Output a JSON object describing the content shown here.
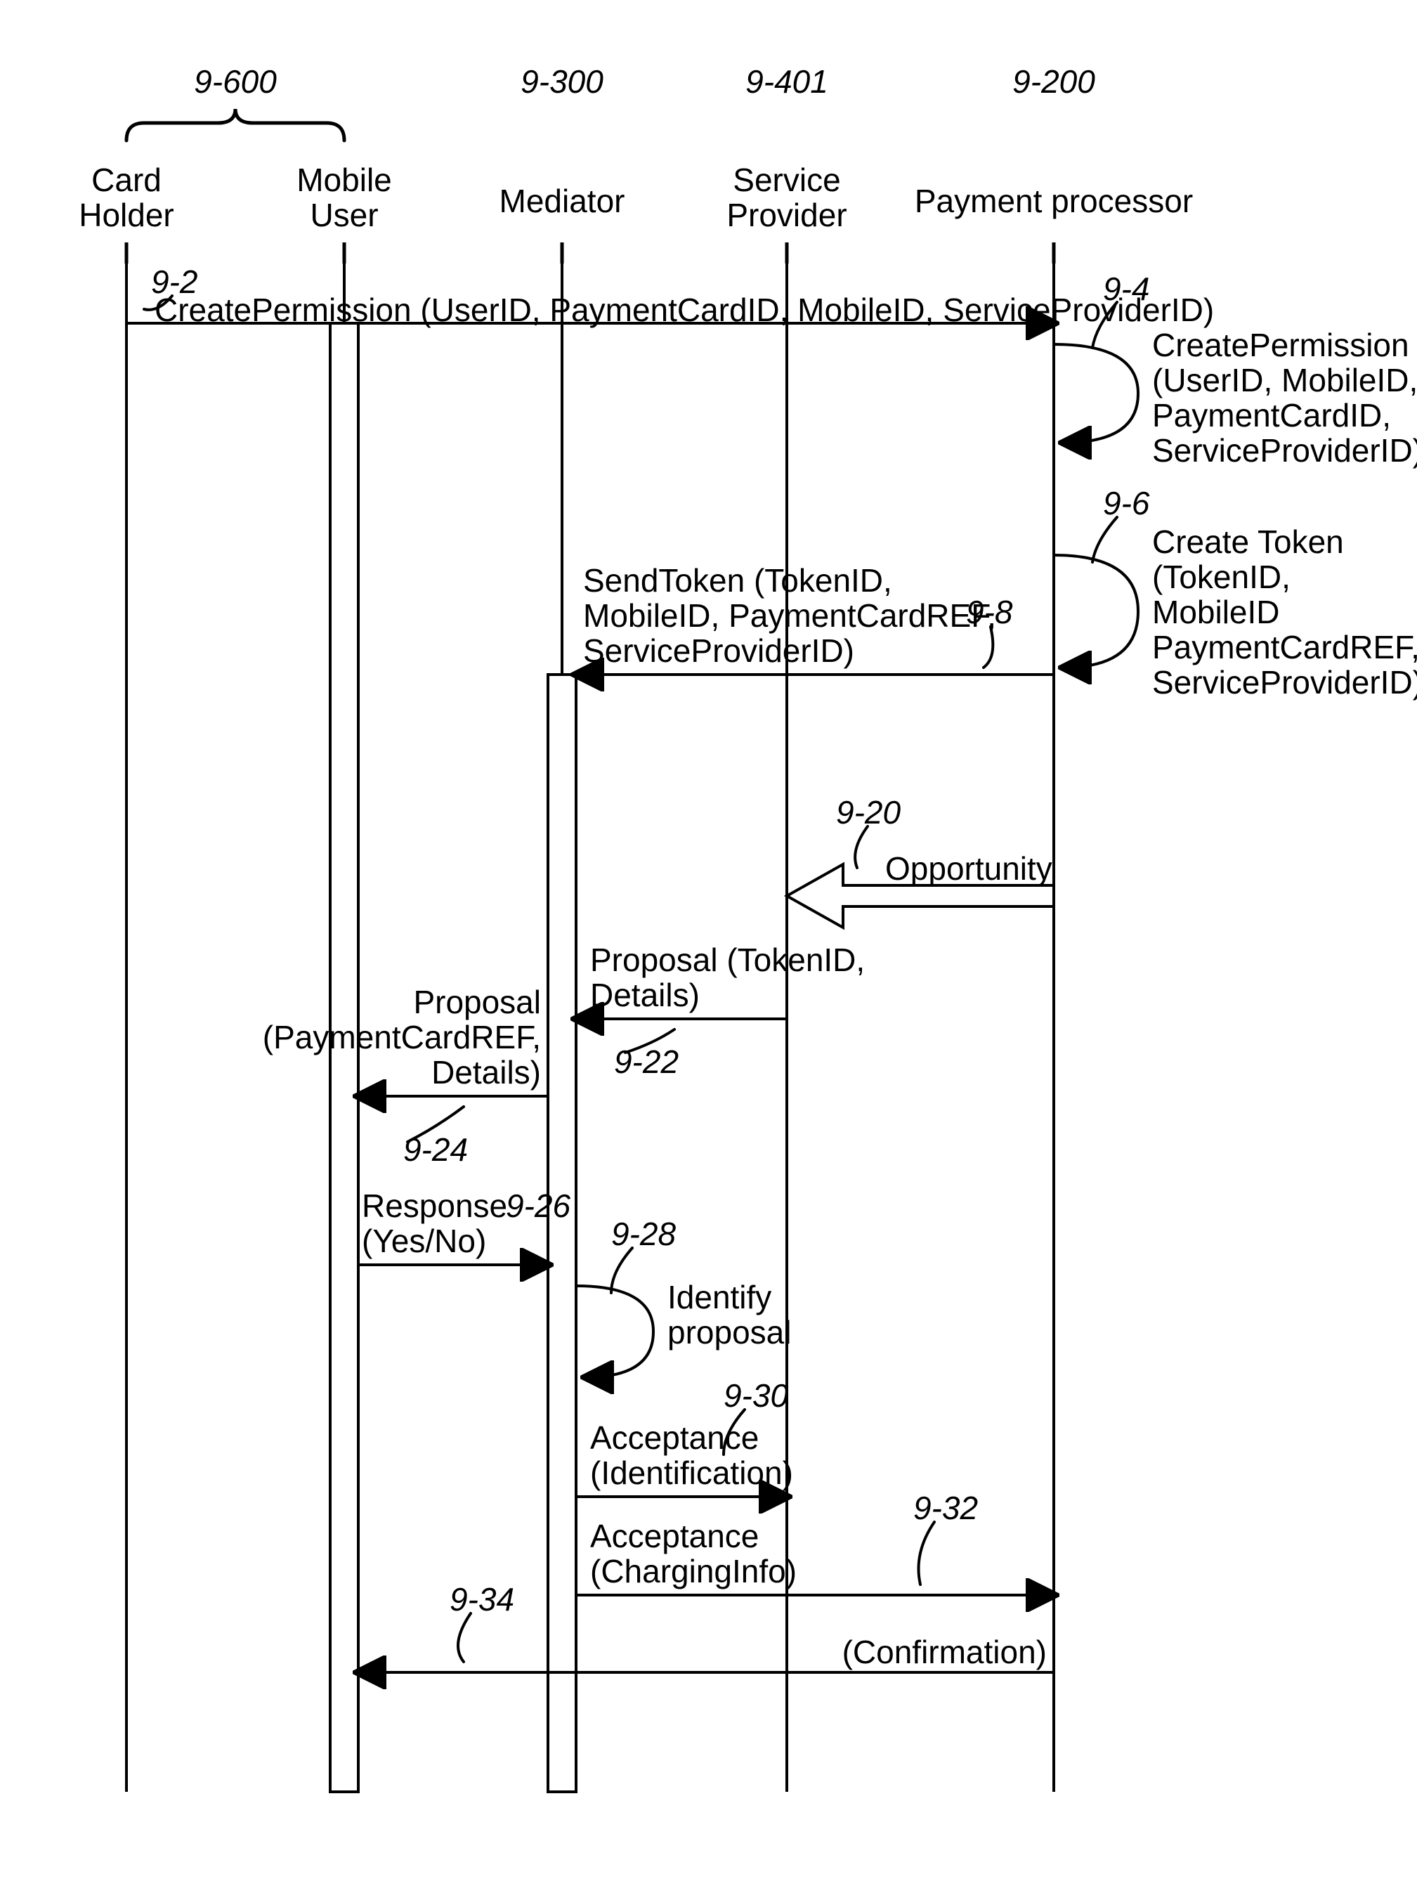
{
  "actors": {
    "cardholder": {
      "ref": "9-600",
      "label1": "Card",
      "label2": "Holder"
    },
    "mobileuser": {
      "label1": "Mobile",
      "label2": "User"
    },
    "mediator": {
      "ref": "9-300",
      "label1": "Mediator"
    },
    "provider": {
      "ref": "9-401",
      "label1": "Service",
      "label2": "Provider"
    },
    "processor": {
      "ref": "9-200",
      "label1": "Payment processor"
    }
  },
  "msgs": {
    "m2": {
      "ref": "9-2",
      "text": "CreatePermission (UserID, PaymentCardID, MobileID, ServiceProviderID)"
    },
    "m4": {
      "ref": "9-4",
      "text": [
        "CreatePermission",
        "(UserID, MobileID,",
        "PaymentCardID,",
        "ServiceProviderID)"
      ]
    },
    "m6": {
      "ref": "9-6",
      "text": [
        "Create Token",
        "(TokenID,",
        "MobileID",
        "PaymentCardREF,",
        "ServiceProviderID)"
      ]
    },
    "m8": {
      "ref": "9-8",
      "text": [
        "SendToken (TokenID,",
        "MobileID, PaymentCardREF,",
        "ServiceProviderID)"
      ]
    },
    "m20": {
      "ref": "9-20",
      "text": "Opportunity"
    },
    "m22": {
      "ref": "9-22",
      "text": [
        "Proposal (TokenID,",
        "Details)"
      ]
    },
    "m24": {
      "ref": "9-24",
      "text": [
        "Proposal",
        "(PaymentCardREF,",
        "Details)"
      ]
    },
    "m26": {
      "ref": "9-26",
      "text": [
        "Response",
        "(Yes/No)"
      ]
    },
    "m28": {
      "ref": "9-28",
      "text": [
        "Identify",
        "proposal"
      ]
    },
    "m30": {
      "ref": "9-30",
      "text": [
        "Acceptance",
        "(Identification)"
      ]
    },
    "m32": {
      "ref": "9-32",
      "text": [
        "Acceptance",
        "(ChargingInfo)"
      ]
    },
    "m34": {
      "ref": "9-34",
      "text": "(Confirmation)"
    }
  }
}
